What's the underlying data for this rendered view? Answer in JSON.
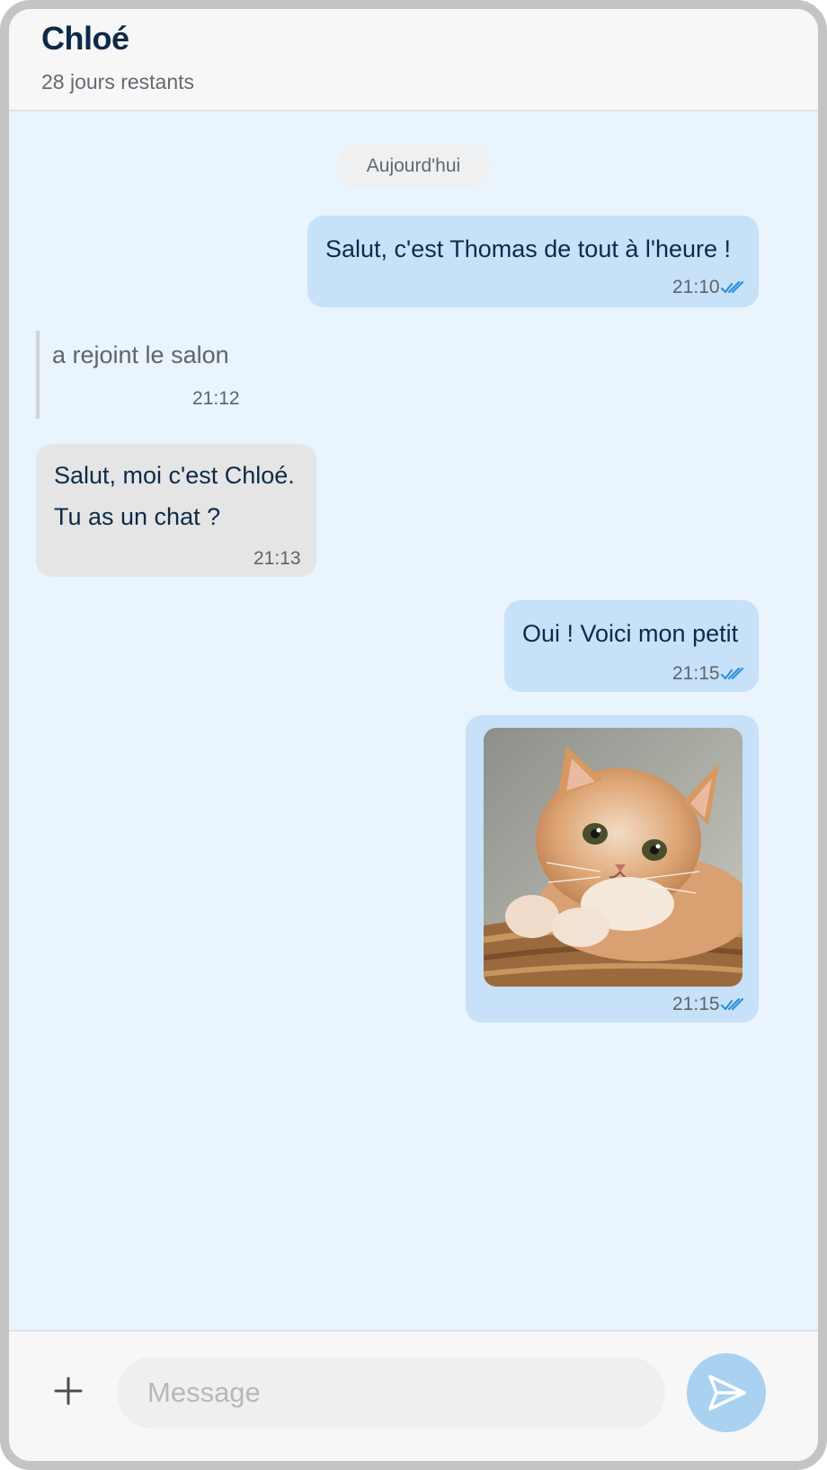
{
  "header": {
    "contact_name": "Chloé",
    "subtitle": "28 jours restants"
  },
  "conversation": {
    "date_separator": "Aujourd'hui",
    "messages": [
      {
        "direction": "outgoing",
        "type": "text",
        "text": "Salut, c'est Thomas de tout à l'heure !",
        "time": "21:10",
        "status_icon": "double-check-icon"
      },
      {
        "direction": "system",
        "type": "event",
        "text": "a rejoint le salon",
        "time": "21:12"
      },
      {
        "direction": "incoming",
        "type": "text",
        "lines": [
          "Salut, moi c'est Chloé.",
          "Tu as un chat ?"
        ],
        "time": "21:13"
      },
      {
        "direction": "outgoing",
        "type": "text",
        "text": "Oui ! Voici mon petit",
        "time": "21:15",
        "status_icon": "double-check-icon"
      },
      {
        "direction": "outgoing",
        "type": "image",
        "image": "cat-photo",
        "time": "21:15",
        "status_icon": "double-check-icon"
      }
    ]
  },
  "composer": {
    "add_icon": "plus-icon",
    "placeholder": "Message",
    "value": "",
    "send_icon": "send-icon"
  },
  "colors": {
    "chat_background": "#eaf4fd",
    "outgoing_bubble": "#c6e1f8",
    "incoming_bubble": "#e5e5e5",
    "read_check": "#2f8fd8",
    "send_button": "#a9d2f1"
  }
}
